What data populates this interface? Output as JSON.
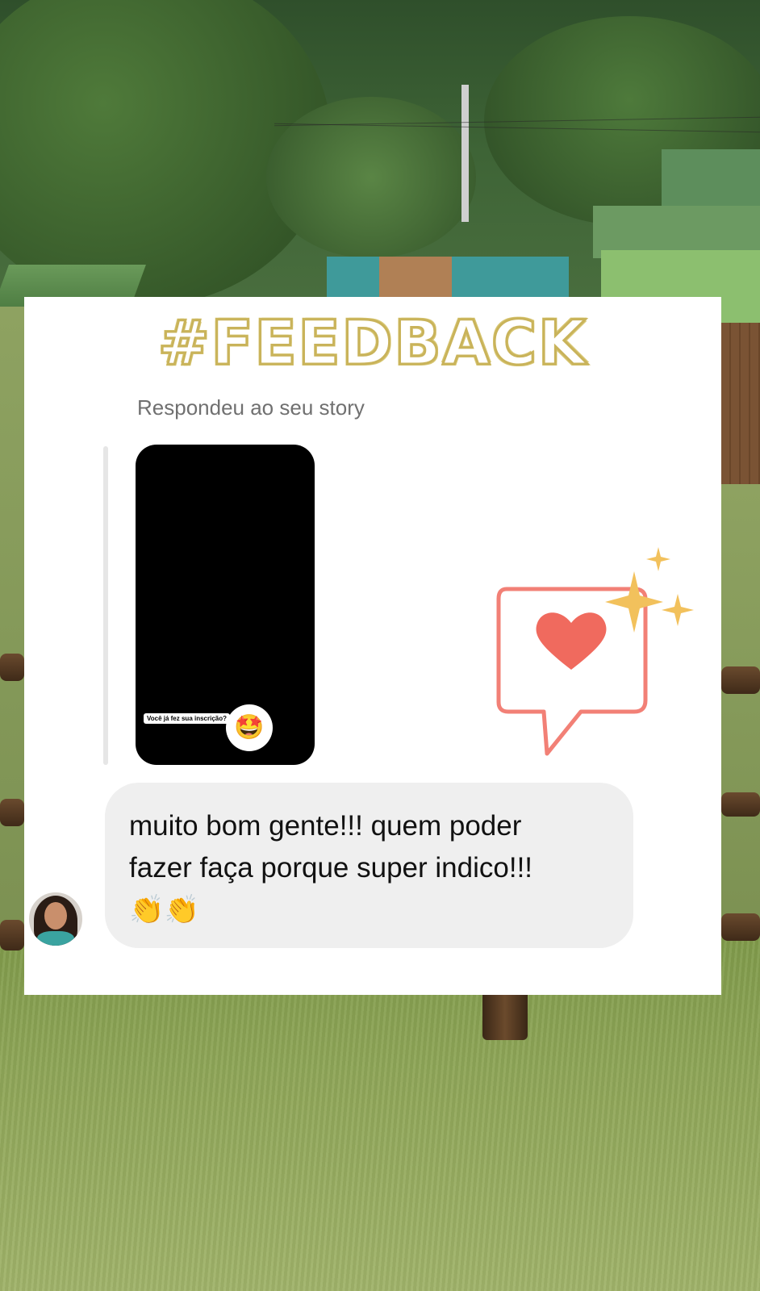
{
  "post": {
    "title": "#FEEDBACK",
    "reply_caption": "Respondeu ao seu story",
    "story_sticker": "Você já fez sua inscrição?",
    "story_emoji": "🤩",
    "message_line1": "muito bom gente!!! quem poder",
    "message_line2": "fazer faça porque super indico!!!",
    "message_emoji": "👏👏"
  },
  "decor": {
    "heart_icon": "heart-speech-bubble-icon",
    "sparkle_icon": "sparkle-icon",
    "colors": {
      "title_outline": "#c9b35a",
      "bubble": "#efefef",
      "heart": "#f06a5e",
      "sparkle": "#f2c15c"
    }
  }
}
